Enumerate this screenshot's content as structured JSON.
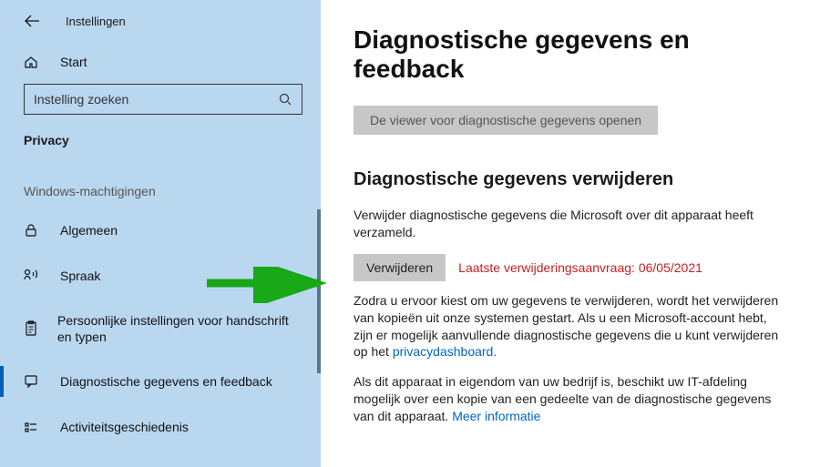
{
  "sidebar": {
    "appTitle": "Instellingen",
    "home": "Start",
    "searchPlaceholder": "Instelling zoeken",
    "category": "Privacy",
    "sectionHeader": "Windows-machtigingen",
    "items": {
      "general": "Algemeen",
      "speech": "Spraak",
      "ink": "Persoonlijke instellingen voor handschrift en typen",
      "diag": "Diagnostische gegevens en feedback",
      "activity": "Activiteitsgeschiedenis"
    }
  },
  "main": {
    "pageTitle": "Diagnostische gegevens en feedback",
    "viewerButton": "De viewer voor diagnostische gegevens openen",
    "deleteSection": {
      "title": "Diagnostische gegevens verwijderen",
      "intro": "Verwijder diagnostische gegevens die Microsoft over dit apparaat heeft verzameld.",
      "button": "Verwijderen",
      "status": "Laatste verwijderingsaanvraag: 06/05/2021",
      "para1a": "Zodra u ervoor kiest om uw gegevens te verwijderen, wordt het verwijderen van kopieën uit onze systemen gestart. Als u een Microsoft-account hebt, zijn er mogelijk aanvullende diagnostische gegevens die u kunt verwijderen op het ",
      "para1link": "privacydashboard.",
      "para2a": "Als dit apparaat in eigendom van uw bedrijf is, beschikt uw IT-afdeling mogelijk over een kopie van een gedeelte van de diagnostische gegevens van dit apparaat. ",
      "para2link": "Meer informatie"
    }
  }
}
